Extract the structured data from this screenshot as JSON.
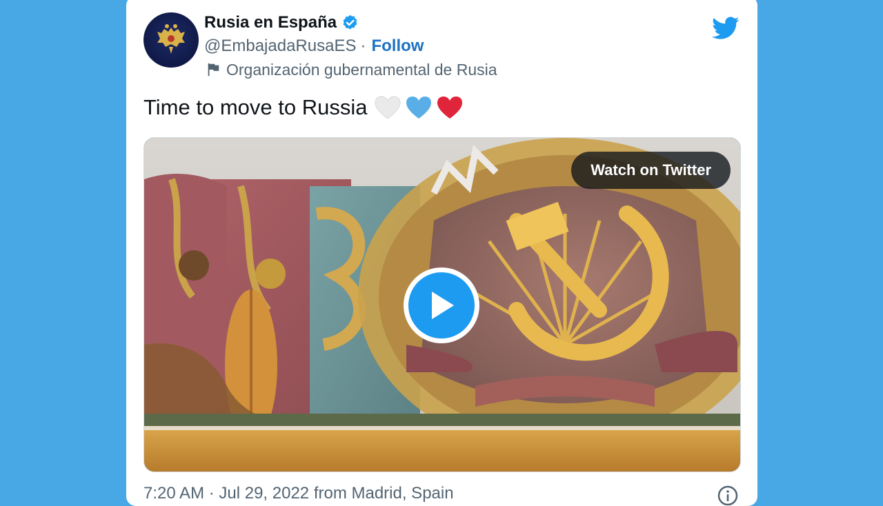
{
  "account": {
    "name": "Rusia en España",
    "handle": "@EmbajadaRusaES",
    "separator": "·",
    "follow_label": "Follow",
    "account_label": "Organización gubernamental de Rusia",
    "verified_icon": "verified-badge-icon",
    "avatar_icon": "russian-coat-of-arms-icon"
  },
  "tweet": {
    "text": "Time to move to Russia",
    "emojis": [
      "white-heart",
      "blue-heart",
      "red-heart"
    ]
  },
  "media": {
    "watch_label": "Watch on Twitter",
    "play_icon": "play-icon"
  },
  "meta": {
    "timestamp": "7:20 AM · Jul 29, 2022 from Madrid, Spain"
  },
  "colors": {
    "page_bg": "#48a8e6",
    "brand_blue": "#1d9bf0",
    "follow_blue": "#1d72c2",
    "text_primary": "#0f1419",
    "text_secondary": "#536471",
    "heart_red": "#e0243a",
    "heart_blue": "#5aaee8",
    "heart_white": "#e8e8e8"
  }
}
